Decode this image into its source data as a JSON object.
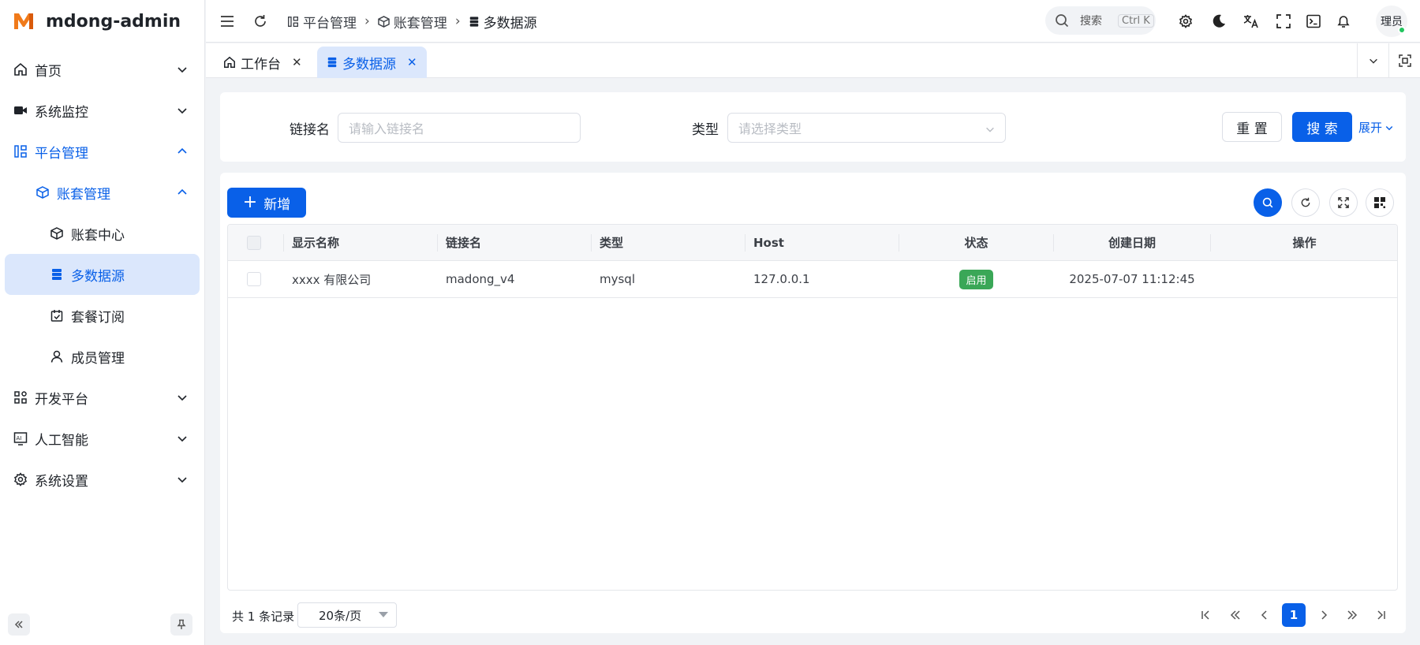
{
  "app": {
    "name": "mdong-admin"
  },
  "sidebar": {
    "items": [
      {
        "label": "首页"
      },
      {
        "label": "系统监控"
      },
      {
        "label": "平台管理"
      },
      {
        "label": "账套管理"
      },
      {
        "label": "账套中心"
      },
      {
        "label": "多数据源"
      },
      {
        "label": "套餐订阅"
      },
      {
        "label": "成员管理"
      },
      {
        "label": "开发平台"
      },
      {
        "label": "人工智能"
      },
      {
        "label": "系统设置"
      }
    ]
  },
  "header": {
    "breadcrumb": [
      "平台管理",
      "账套管理",
      "多数据源"
    ],
    "search_label": "搜索",
    "search_shortcut": "Ctrl K",
    "user": "理员"
  },
  "tabs": [
    {
      "label": "工作台"
    },
    {
      "label": "多数据源"
    }
  ],
  "filters": {
    "link_label": "链接名",
    "link_placeholder": "请输入链接名",
    "type_label": "类型",
    "type_placeholder": "请选择类型",
    "reset": "重 置",
    "search": "搜 索",
    "expand": "展开"
  },
  "toolbar": {
    "add": "新增"
  },
  "table": {
    "columns": [
      "显示名称",
      "链接名",
      "类型",
      "Host",
      "状态",
      "创建日期",
      "操作"
    ],
    "rows": [
      {
        "name": "xxxx 有限公司",
        "link": "madong_v4",
        "type": "mysql",
        "host": "127.0.0.1",
        "status": "启用",
        "created": "2025-07-07 11:12:45",
        "actions": ""
      }
    ]
  },
  "pagination": {
    "total_text": "共 1 条记录",
    "page_size": "20条/页",
    "current_page": "1"
  },
  "colors": {
    "primary": "#0960e8",
    "active_bg": "#dbe7fc",
    "success": "#3aa757"
  }
}
